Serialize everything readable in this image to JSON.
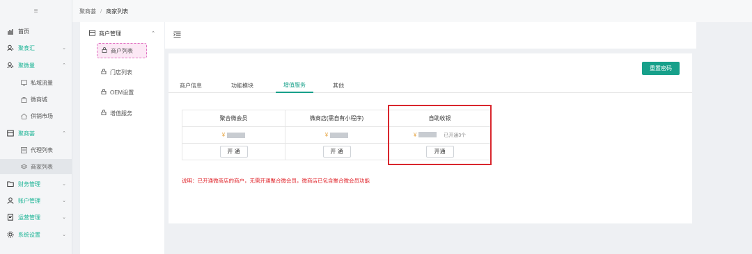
{
  "sidebar": {
    "toggle_icon": "menu-fold-icon",
    "items": [
      {
        "label": "首页",
        "icon": "chart-icon"
      },
      {
        "label": "聚食汇",
        "icon": "user-search-icon"
      },
      {
        "label": "聚微量",
        "icon": "user-search-icon"
      },
      {
        "label": "私域流量",
        "icon": "monitor-icon"
      },
      {
        "label": "微商城",
        "icon": "shop-icon"
      },
      {
        "label": "供销市场",
        "icon": "house-icon"
      },
      {
        "label": "聚商荟",
        "icon": "storefront-icon"
      },
      {
        "label": "代理列表",
        "icon": "list-icon"
      },
      {
        "label": "商家列表",
        "icon": "layers-icon"
      },
      {
        "label": "财务管理",
        "icon": "folder-icon"
      },
      {
        "label": "账户管理",
        "icon": "person-icon"
      },
      {
        "label": "运营管理",
        "icon": "document-icon"
      },
      {
        "label": "系统设置",
        "icon": "gear-icon"
      }
    ]
  },
  "breadcrumb": {
    "root": "聚商荟",
    "separator": "/",
    "current": "商家列表"
  },
  "subnav": {
    "group": "商户管理",
    "items": [
      {
        "label": "商户列表"
      },
      {
        "label": "门店列表"
      },
      {
        "label": "OEM设置"
      },
      {
        "label": "增值服务"
      }
    ]
  },
  "main": {
    "reset_button": "重置密码",
    "tabs": [
      {
        "label": "商户信息"
      },
      {
        "label": "功能模块"
      },
      {
        "label": "增值服务"
      },
      {
        "label": "其他"
      }
    ],
    "services": [
      {
        "name": "聚合微会员",
        "currency": "¥",
        "button": "开 通",
        "status": ""
      },
      {
        "name": "微商店(需自有小程序)",
        "currency": "¥",
        "button": "开 通",
        "status": ""
      },
      {
        "name": "自助收银",
        "currency": "¥",
        "button": "开通",
        "status": "已开通3个"
      }
    ],
    "note": "说明：已开通微商店的商户，无需开通聚合微会员，微商店已包含聚合微会员功能"
  },
  "colors": {
    "accent": "#17a08a",
    "highlight_border": "#d9262d",
    "note_text": "#e0262c"
  }
}
